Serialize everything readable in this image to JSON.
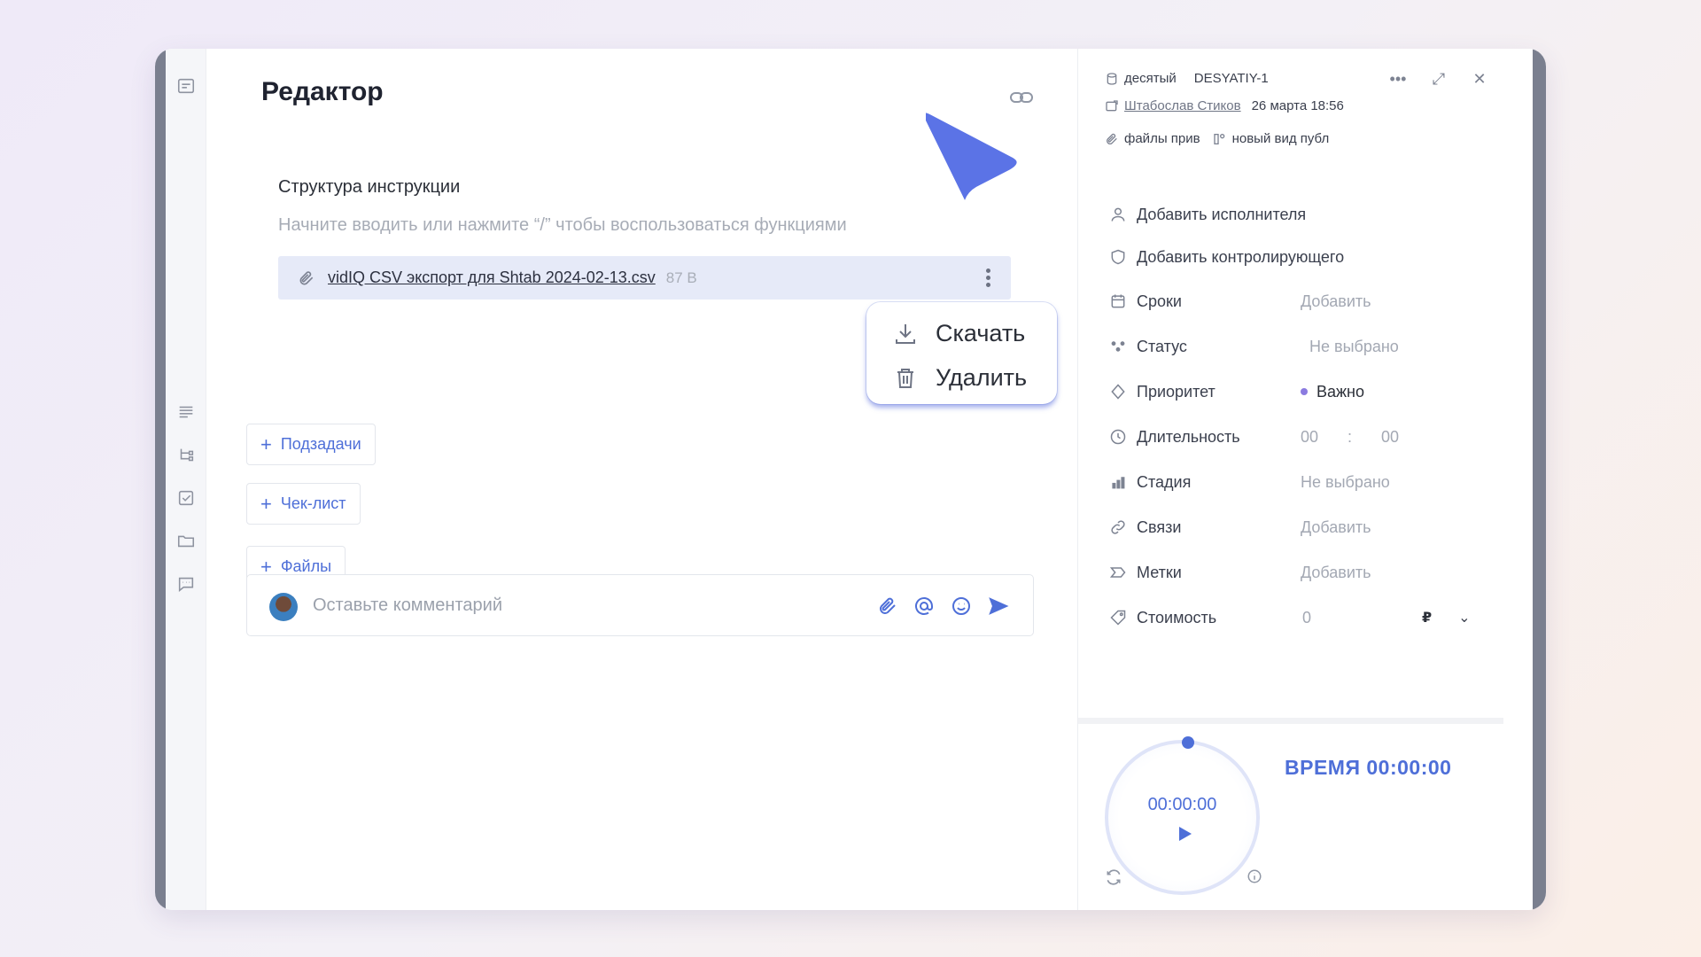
{
  "editor": {
    "title": "Редактор",
    "doc_heading": "Структура инструкции",
    "doc_placeholder": "Начните вводить или нажмите “/” чтобы воспользоваться функциями",
    "file": {
      "name": "vidIQ CSV экспорт для Shtab 2024-02-13.csv",
      "size": "87 B"
    },
    "file_menu": {
      "download": "Скачать",
      "delete": "Удалить"
    },
    "add_buttons": {
      "subtasks": "Подзадачи",
      "checklist": "Чек-лист",
      "files": "Файлы"
    },
    "comment": {
      "placeholder": "Оставьте комментарий"
    }
  },
  "panel": {
    "project": "десятый",
    "task_id": "DESYATIY-1",
    "author": "Штабослав Стиков",
    "date": "26 марта 18:56",
    "tags": {
      "files": "файлы прив",
      "view": "новый вид публ"
    },
    "add_assignee": "Добавить исполнителя",
    "add_controller": "Добавить контролирующего",
    "props": [
      {
        "label": "Сроки",
        "value": "Добавить",
        "icon": "calendar-icon"
      },
      {
        "label": "Статус",
        "value": "Не выбрано",
        "icon": "status-icon"
      },
      {
        "label": "Приоритет",
        "value": "Важно",
        "icon": "priority-icon"
      },
      {
        "label": "Длительность",
        "value": "00 : 00",
        "icon": "clock-icon"
      },
      {
        "label": "Стадия",
        "value": "Не выбрано",
        "icon": "stage-icon"
      },
      {
        "label": "Связи",
        "value": "Добавить",
        "icon": "link-icon"
      },
      {
        "label": "Метки",
        "value": "Добавить",
        "icon": "tag-icon"
      },
      {
        "label": "Стоимость",
        "value": "0",
        "icon": "price-icon"
      }
    ],
    "currency": "₽",
    "priority_color": "#8b7be0"
  },
  "timer": {
    "display": "00:00:00",
    "label": "ВРЕМЯ 00:00:00"
  },
  "colors": {
    "accent": "#4e6fd8",
    "cursor": "#5b73e6"
  }
}
